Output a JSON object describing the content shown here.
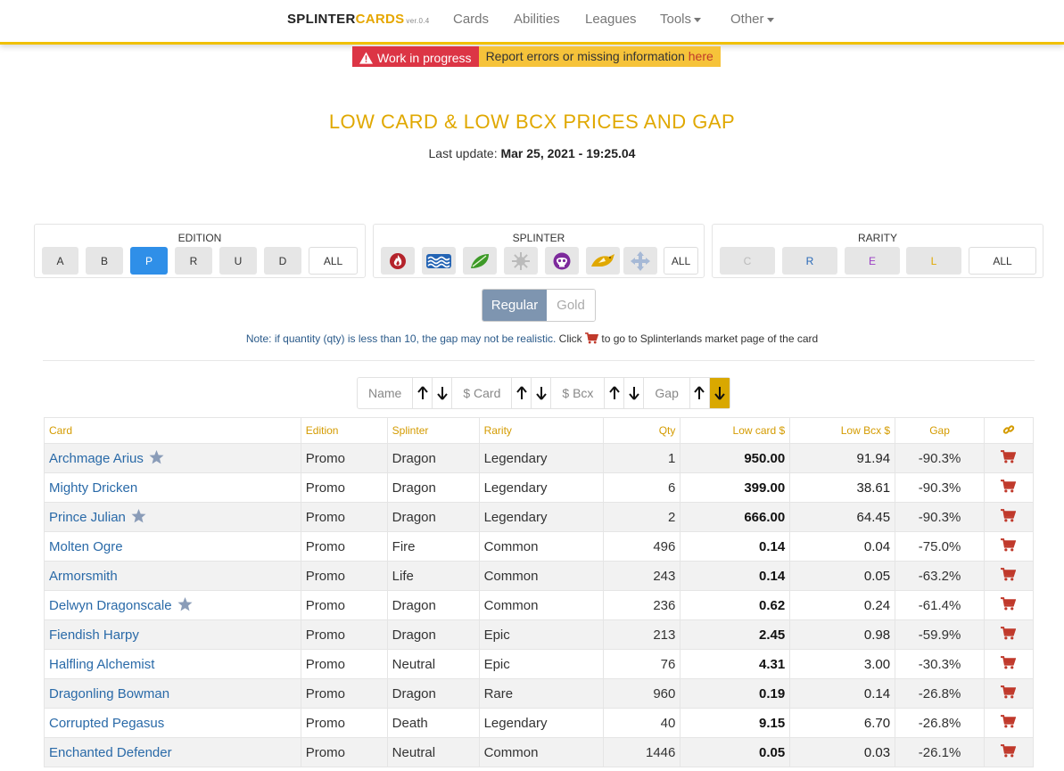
{
  "navbar": {
    "brand_part1": "SPLINTER",
    "brand_part2": "CARDS",
    "version": "ver.0.4",
    "items": [
      "Cards",
      "Abilities",
      "Leagues",
      "Tools",
      "Other"
    ]
  },
  "banner": {
    "wip_label": "Work in progress",
    "report_text": "Report errors or missing information",
    "report_link": "here"
  },
  "page": {
    "title": "LOW CARD & LOW BCX PRICES AND GAP",
    "update_label": "Last update:",
    "update_value": "Mar 25, 2021 - 19:25.04"
  },
  "filters": {
    "edition": {
      "title": "EDITION",
      "options": [
        "A",
        "B",
        "P",
        "R",
        "U",
        "D"
      ],
      "selected": "P",
      "all_label": "ALL"
    },
    "splinter": {
      "title": "SPLINTER",
      "icons": [
        "fire-icon",
        "water-icon",
        "earth-icon",
        "life-icon",
        "death-icon",
        "dragon-icon",
        "neutral-icon"
      ],
      "all_label": "ALL"
    },
    "rarity": {
      "title": "RARITY",
      "options": [
        "C",
        "R",
        "E",
        "L"
      ],
      "colors": [
        "#bbbbbb",
        "#2a6ab8",
        "#9b3fc4",
        "#e0a800"
      ],
      "all_label": "ALL"
    }
  },
  "foil_toggle": {
    "regular": "Regular",
    "gold": "Gold",
    "selected": "Regular"
  },
  "note": {
    "text1": "Note: if quantity (qty) is less than 10, the gap may not be realistic.",
    "text2": "Click",
    "text3": "to go to Splinterlands market page of the card"
  },
  "sort": {
    "fields": [
      "Name",
      "$ Card",
      "$ Bcx",
      "Gap"
    ],
    "active": "Gap descending"
  },
  "table": {
    "headers": [
      "Card",
      "Edition",
      "Splinter",
      "Rarity",
      "Qty",
      "Low card $",
      "Low Bcx $",
      "Gap"
    ],
    "rows": [
      {
        "card": "Archmage Arius",
        "star": true,
        "edition": "Promo",
        "splinter": "Dragon",
        "rarity": "Legendary",
        "qty": "1",
        "low_card": "950.00",
        "low_bcx": "91.94",
        "gap": "-90.3%",
        "gap_color": "red"
      },
      {
        "card": "Mighty Dricken",
        "star": false,
        "edition": "Promo",
        "splinter": "Dragon",
        "rarity": "Legendary",
        "qty": "6",
        "low_card": "399.00",
        "low_bcx": "38.61",
        "gap": "-90.3%",
        "gap_color": "red"
      },
      {
        "card": "Prince Julian",
        "star": true,
        "edition": "Promo",
        "splinter": "Dragon",
        "rarity": "Legendary",
        "qty": "2",
        "low_card": "666.00",
        "low_bcx": "64.45",
        "gap": "-90.3%",
        "gap_color": "red"
      },
      {
        "card": "Molten Ogre",
        "star": false,
        "edition": "Promo",
        "splinter": "Fire",
        "rarity": "Common",
        "qty": "496",
        "low_card": "0.14",
        "low_bcx": "0.04",
        "gap": "-75.0%",
        "gap_color": "red"
      },
      {
        "card": "Armorsmith",
        "star": false,
        "edition": "Promo",
        "splinter": "Life",
        "rarity": "Common",
        "qty": "243",
        "low_card": "0.14",
        "low_bcx": "0.05",
        "gap": "-63.2%",
        "gap_color": "green"
      },
      {
        "card": "Delwyn Dragonscale",
        "star": true,
        "edition": "Promo",
        "splinter": "Dragon",
        "rarity": "Common",
        "qty": "236",
        "low_card": "0.62",
        "low_bcx": "0.24",
        "gap": "-61.4%",
        "gap_color": "green"
      },
      {
        "card": "Fiendish Harpy",
        "star": false,
        "edition": "Promo",
        "splinter": "Dragon",
        "rarity": "Epic",
        "qty": "213",
        "low_card": "2.45",
        "low_bcx": "0.98",
        "gap": "-59.9%",
        "gap_color": "green"
      },
      {
        "card": "Halfling Alchemist",
        "star": false,
        "edition": "Promo",
        "splinter": "Neutral",
        "rarity": "Epic",
        "qty": "76",
        "low_card": "4.31",
        "low_bcx": "3.00",
        "gap": "-30.3%",
        "gap_color": "teal"
      },
      {
        "card": "Dragonling Bowman",
        "star": false,
        "edition": "Promo",
        "splinter": "Dragon",
        "rarity": "Rare",
        "qty": "960",
        "low_card": "0.19",
        "low_bcx": "0.14",
        "gap": "-26.8%",
        "gap_color": "teal"
      },
      {
        "card": "Corrupted Pegasus",
        "star": false,
        "edition": "Promo",
        "splinter": "Death",
        "rarity": "Legendary",
        "qty": "40",
        "low_card": "9.15",
        "low_bcx": "6.70",
        "gap": "-26.8%",
        "gap_color": "teal"
      },
      {
        "card": "Enchanted Defender",
        "star": false,
        "edition": "Promo",
        "splinter": "Neutral",
        "rarity": "Common",
        "qty": "1446",
        "low_card": "0.05",
        "low_bcx": "0.03",
        "gap": "-26.1%",
        "gap_color": "teal"
      }
    ]
  },
  "colors": {
    "accent": "#e0a800",
    "active_button": "#2f8fe8",
    "danger": "#dc3545",
    "cart": "#c0392b",
    "link": "#2a6aa8"
  }
}
